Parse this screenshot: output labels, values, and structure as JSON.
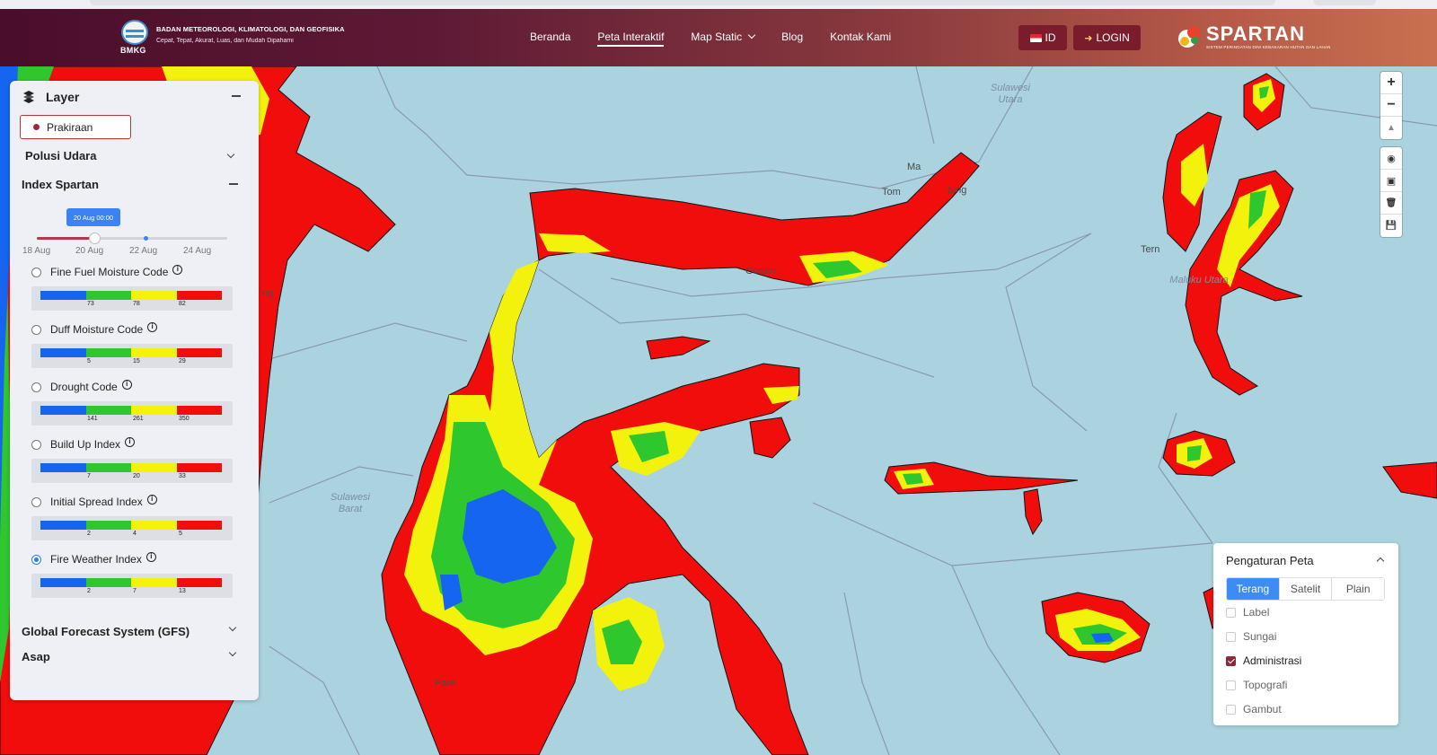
{
  "header": {
    "org_name": "BADAN METEOROLOGI, KLIMATOLOGI, DAN GEOFISIKA",
    "org_tagline": "Cepat, Tepat, Akurat, Luas, dan Mudah Dipahami",
    "logo_text": "BMKG",
    "nav": [
      "Beranda",
      "Peta Interaktif",
      "Map Static",
      "Blog",
      "Kontak Kami"
    ],
    "lang_button": "ID",
    "login_button": "LOGIN",
    "brand_right": "SPARTAN",
    "brand_right_sub": "SISTEM PERINGATAN DINI KEBAKARAN HUTAN DAN LAHAN"
  },
  "panel": {
    "title": "Layer",
    "chip": "Prakiraan",
    "sections": [
      "Polusi Udara",
      "Index Spartan",
      "Global Forecast System (GFS)",
      "Asap"
    ],
    "slider": {
      "tooltip": "20 Aug 00:00",
      "ticks": [
        "18 Aug",
        "20 Aug",
        "22 Aug",
        "24 Aug"
      ],
      "value_fraction": 0.3,
      "marker_fraction": 0.57
    },
    "indices": [
      {
        "label": "Fine Fuel Moisture Code",
        "levels": [
          "73",
          "78",
          "82"
        ],
        "selected": false
      },
      {
        "label": "Duff Moisture Code",
        "levels": [
          "5",
          "15",
          "29"
        ],
        "selected": false
      },
      {
        "label": "Drought Code",
        "levels": [
          "141",
          "261",
          "350"
        ],
        "selected": false
      },
      {
        "label": "Build Up Index",
        "levels": [
          "7",
          "20",
          "33"
        ],
        "selected": false
      },
      {
        "label": "Initial Spread Index",
        "levels": [
          "2",
          "4",
          "5"
        ],
        "selected": false
      },
      {
        "label": "Fire Weather Index",
        "levels": [
          "2",
          "7",
          "13"
        ],
        "selected": true
      }
    ],
    "legend_colors": [
      "#1565f0",
      "#2ec82e",
      "#f2f20c",
      "#f20d0d"
    ]
  },
  "map": {
    "region_labels": [
      "Sulawesi Utara",
      "Sulawesi Barat",
      "Maluku Utara"
    ],
    "place_labels": [
      "Ma",
      "Tom",
      "tung",
      "Gorom",
      "Tern",
      "ng",
      "Pare"
    ]
  },
  "map_controls": [
    "+",
    "−",
    "▲",
    "◉",
    "▣",
    "🗑",
    "💾"
  ],
  "settings": {
    "title": "Pengaturan Peta",
    "base_layers": [
      "Terang",
      "Satelit",
      "Plain"
    ],
    "active_base": "Terang",
    "overlays": [
      {
        "label": "Label",
        "checked": false
      },
      {
        "label": "Sungai",
        "checked": false
      },
      {
        "label": "Administrasi",
        "checked": true
      },
      {
        "label": "Topografi",
        "checked": false
      },
      {
        "label": "Gambut",
        "checked": false
      }
    ]
  }
}
